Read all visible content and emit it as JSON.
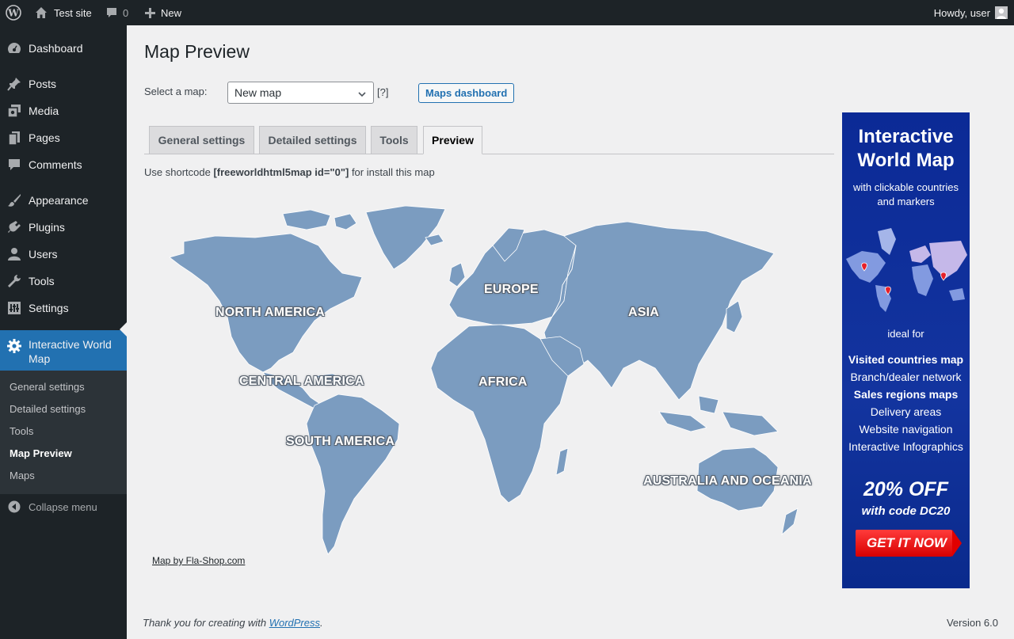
{
  "adminbar": {
    "site_name": "Test site",
    "comments_count": "0",
    "new_label": "New",
    "howdy": "Howdy, user"
  },
  "sidebar": {
    "items": [
      {
        "label": "Dashboard",
        "icon": "dashboard-icon"
      },
      {
        "label": "Posts",
        "icon": "pin-icon"
      },
      {
        "label": "Media",
        "icon": "media-icon"
      },
      {
        "label": "Pages",
        "icon": "pages-icon"
      },
      {
        "label": "Comments",
        "icon": "comments-icon"
      },
      {
        "label": "Appearance",
        "icon": "brush-icon"
      },
      {
        "label": "Plugins",
        "icon": "plugin-icon"
      },
      {
        "label": "Users",
        "icon": "users-icon"
      },
      {
        "label": "Tools",
        "icon": "wrench-icon"
      },
      {
        "label": "Settings",
        "icon": "settings-icon"
      },
      {
        "label": "Interactive World Map",
        "icon": "gear-icon"
      }
    ],
    "submenu": [
      "General settings",
      "Detailed settings",
      "Tools",
      "Map Preview",
      "Maps"
    ],
    "collapse_label": "Collapse menu",
    "current_color": "#2271b1"
  },
  "main": {
    "title": "Map Preview",
    "select_label": "Select a map:",
    "select_value": "New map",
    "help": "[?]",
    "dashboard_button": "Maps dashboard",
    "tabs": [
      "General settings",
      "Detailed settings",
      "Tools",
      "Preview"
    ],
    "active_tab": "Preview",
    "shortcode_prefix": "Use shortcode ",
    "shortcode": "[freeworldhtml5map id=\"0\"]",
    "shortcode_suffix": " for install this map",
    "map_credit": "Map by Fla-Shop.com",
    "map_color": "#7b9cc0",
    "regions": [
      "NORTH AMERICA",
      "CENTRAL AMERICA",
      "SOUTH AMERICA",
      "EUROPE",
      "AFRICA",
      "ASIA",
      "AUSTRALIA AND OCEANIA"
    ]
  },
  "ad": {
    "title_line1": "Interactive",
    "title_line2": "World Map",
    "sub_line1": "with clickable countries",
    "sub_line2": "and markers",
    "ideal": "ideal for",
    "uses": [
      "Visited countries map",
      "Branch/dealer network",
      "Sales regions maps",
      "Delivery areas",
      "Website navigation",
      "Interactive Infographics"
    ],
    "offer": "20% OFF",
    "code": "with code DC20",
    "cta": "GET IT NOW"
  },
  "footer": {
    "thanks_prefix": "Thank you for creating with ",
    "thanks_link": "WordPress",
    "thanks_suffix": ".",
    "version": "Version 6.0"
  }
}
